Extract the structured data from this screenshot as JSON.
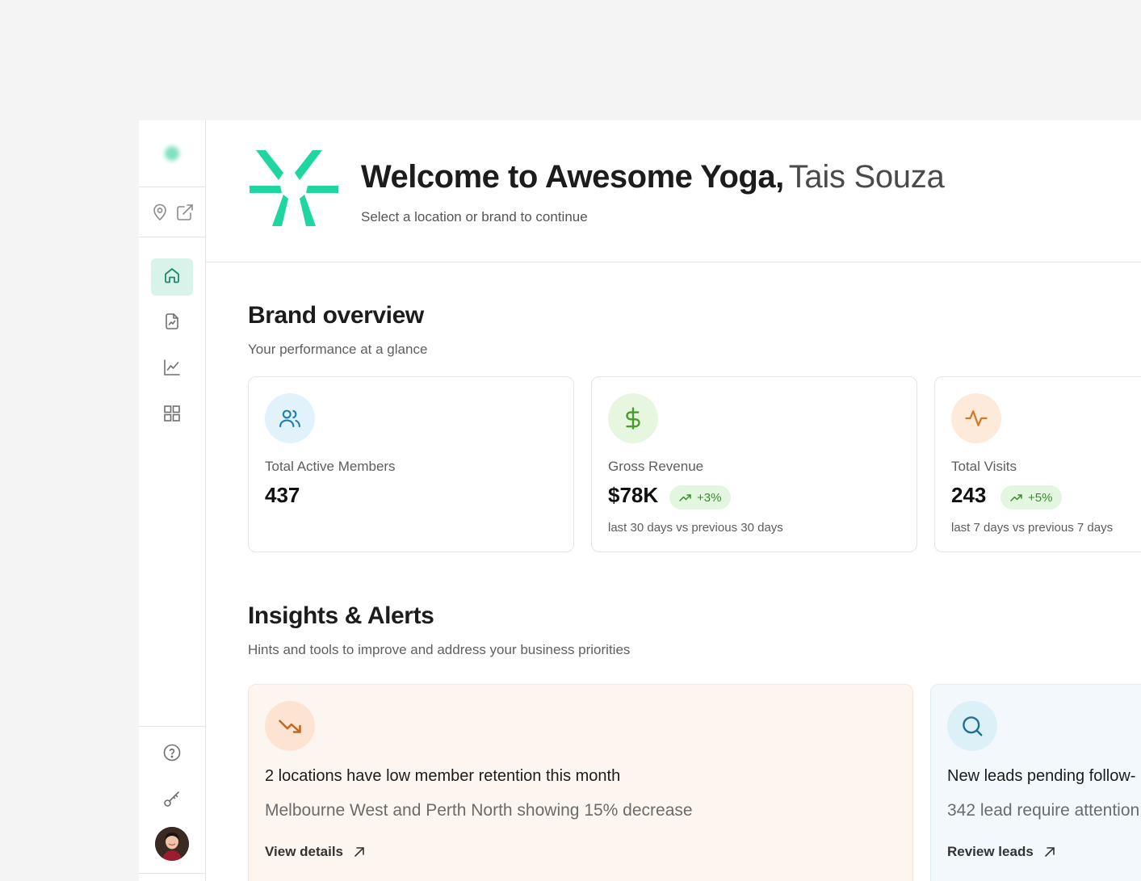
{
  "header": {
    "welcome_text": "Welcome to Awesome Yoga,",
    "user_name": "Tais Souza",
    "subtitle": "Select a location or brand to continue"
  },
  "colors": {
    "brand": "#1fd6a0",
    "nav_active_bg": "#d7f3ea"
  },
  "sidebar": {
    "tools": [
      "location-pin-icon",
      "external-link-icon"
    ],
    "nav": [
      {
        "icon": "home-icon",
        "active": true
      },
      {
        "icon": "report-icon",
        "active": false
      },
      {
        "icon": "line-chart-icon",
        "active": false
      },
      {
        "icon": "grid-icon",
        "active": false
      }
    ],
    "bottom": [
      "help-icon",
      "key-icon",
      "avatar"
    ]
  },
  "brand_overview": {
    "title": "Brand overview",
    "subtitle": "Your performance at a glance",
    "cards": [
      {
        "icon": "users-icon",
        "label": "Total Active Members",
        "value": "437"
      },
      {
        "icon": "dollar-icon",
        "label": "Gross Revenue",
        "value": "$78K",
        "trend": "+3%",
        "note": "last 30 days vs previous 30 days"
      },
      {
        "icon": "activity-icon",
        "label": "Total Visits",
        "value": "243",
        "trend": "+5%",
        "note": "last 7 days vs previous 7 days"
      }
    ]
  },
  "insights": {
    "title": "Insights & Alerts",
    "subtitle": "Hints and tools to improve and address your business priorities",
    "cards": [
      {
        "icon": "trending-down-icon",
        "title": "2 locations have low member retention this month",
        "desc": "Melbourne West and Perth North showing 15% decrease",
        "link": "View details"
      },
      {
        "icon": "search-icon",
        "title": "New leads pending follow-",
        "desc": "342 lead require attention",
        "link": "Review leads"
      }
    ]
  }
}
